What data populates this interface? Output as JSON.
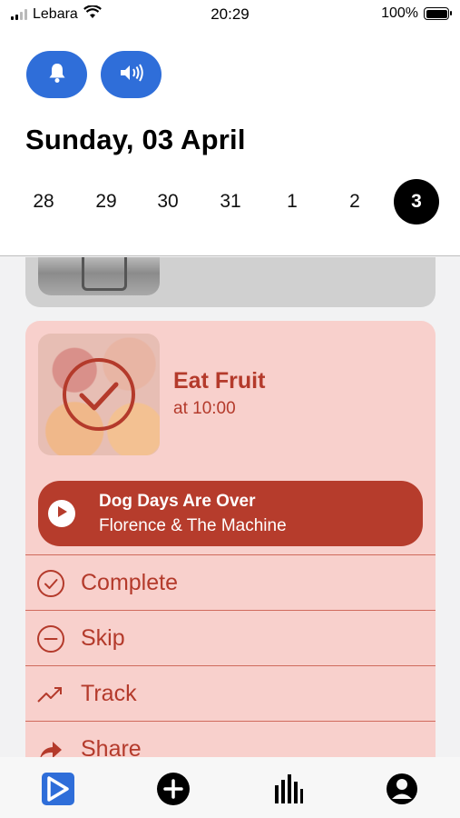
{
  "status_bar": {
    "carrier": "Lebara",
    "time": "20:29",
    "battery": "100%",
    "icons": [
      "signal-icon",
      "wifi-icon",
      "battery-icon"
    ]
  },
  "header": {
    "buttons": [
      {
        "name": "bell-icon"
      },
      {
        "name": "speaker-icon"
      }
    ],
    "date_title": "Sunday, 03 April",
    "days": [
      "28",
      "29",
      "30",
      "31",
      "1",
      "2",
      "3"
    ],
    "selected_day": "3"
  },
  "card": {
    "title": "Eat Fruit",
    "time": "at 10:00",
    "status_icon": "checkmark-circle-icon",
    "player": {
      "song": "Dog Days Are Over",
      "artist": "Florence & The Machine",
      "icon": "play-icon"
    },
    "actions": [
      {
        "label": "Complete",
        "icon": "check-circle-icon"
      },
      {
        "label": "Skip",
        "icon": "minus-circle-icon"
      },
      {
        "label": "Track",
        "icon": "trend-icon"
      },
      {
        "label": "Share",
        "icon": "share-arrow-icon"
      }
    ]
  },
  "tab_bar": {
    "tabs": [
      "app-logo-icon",
      "add-icon",
      "stats-icon",
      "profile-icon"
    ]
  },
  "colors": {
    "accent_blue": "#2f6ed9",
    "card_bg": "#f8d0cc",
    "card_text": "#b43a2b",
    "player_bg": "#b63c2c"
  }
}
